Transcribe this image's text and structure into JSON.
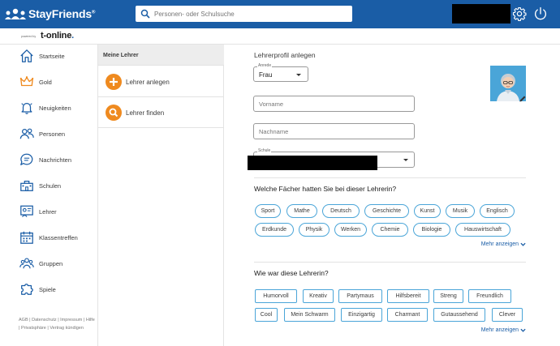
{
  "header": {
    "logo_text": "StayFriends",
    "logo_mark": "®",
    "search_placeholder": "Personen- oder Schulsuche",
    "powered_by": "powered by",
    "partner_logo": "t-online",
    "partner_dot": "."
  },
  "sidebar": {
    "items": [
      {
        "label": "Startseite",
        "icon": "home-icon"
      },
      {
        "label": "Gold",
        "icon": "crown-icon"
      },
      {
        "label": "Neuigkeiten",
        "icon": "bell-icon"
      },
      {
        "label": "Personen",
        "icon": "people-icon"
      },
      {
        "label": "Nachrichten",
        "icon": "chat-icon"
      },
      {
        "label": "Schulen",
        "icon": "school-icon"
      },
      {
        "label": "Lehrer",
        "icon": "teacher-icon"
      },
      {
        "label": "Klassentreffen",
        "icon": "calendar-icon"
      },
      {
        "label": "Gruppen",
        "icon": "groups-icon"
      },
      {
        "label": "Spiele",
        "icon": "puzzle-icon"
      }
    ],
    "footer": "AGB | Datenschutz | Impressum | Hilfe | Privatsphäre | Vertrag kündigen"
  },
  "teacher_menu": {
    "title": "Meine Lehrer",
    "add_label": "Lehrer anlegen",
    "find_label": "Lehrer finden"
  },
  "form": {
    "title": "Lehrerprofil anlegen",
    "anrede_caption": "Anrede",
    "anrede_value": "Frau",
    "vorname_placeholder": "Vorname",
    "nachname_placeholder": "Nachname",
    "schule_caption": "Schule"
  },
  "subjects": {
    "question": "Welche Fächer hatten Sie bei dieser Lehrerin?",
    "items": [
      "Sport",
      "Mathe",
      "Deutsch",
      "Geschichte",
      "Kunst",
      "Musik",
      "Englisch",
      "Erdkunde",
      "Physik",
      "Werken",
      "Chemie",
      "Biologie",
      "Hauswirtschaft"
    ],
    "more": "Mehr anzeigen"
  },
  "traits": {
    "question": "Wie war diese Lehrerin?",
    "items": [
      "Humorvoll",
      "Kreativ",
      "Partymaus",
      "Hilfsbereit",
      "Streng",
      "Freundlich",
      "Cool",
      "Mein Schwarm",
      "Einzigartig",
      "Charmant",
      "Gutaussehend",
      "Clever"
    ],
    "more": "Mehr anzeigen"
  },
  "colors": {
    "brand_blue": "#1a5da6",
    "accent_orange": "#ef8a1f",
    "chip_border": "#4aa5d8"
  }
}
